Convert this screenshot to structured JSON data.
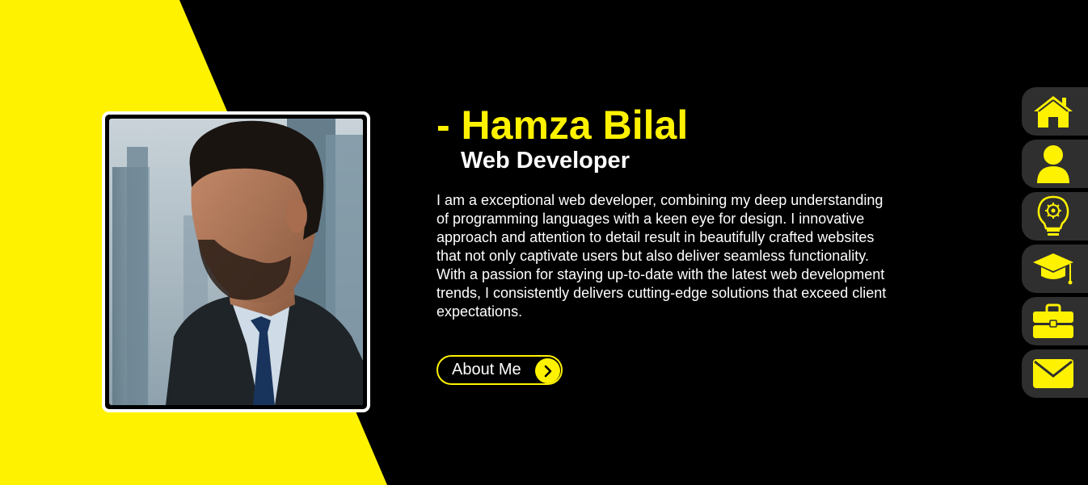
{
  "hero": {
    "name": "- Hamza Bilal",
    "role": "Web Developer",
    "bio": "I am a exceptional web developer, combining my deep understanding of programming languages with a keen eye for design. I innovative approach and attention to detail result in beautifully crafted websites that not only captivate users but also deliver seamless functionality. With a passion for staying up-to-date with the latest web development trends, I consistently delivers cutting-edge solutions that exceed client expectations.",
    "button_label": "About Me"
  },
  "colors": {
    "accent": "#fff200",
    "background": "#000000",
    "nav_background": "#2f2f2f",
    "text": "#ffffff"
  },
  "side_nav": {
    "items": [
      {
        "icon": "home-icon"
      },
      {
        "icon": "user-icon"
      },
      {
        "icon": "lightbulb-icon"
      },
      {
        "icon": "graduation-cap-icon"
      },
      {
        "icon": "briefcase-icon"
      },
      {
        "icon": "envelope-icon"
      }
    ]
  }
}
